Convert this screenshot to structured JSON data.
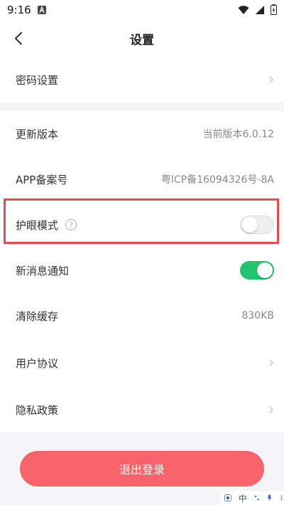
{
  "status_bar": {
    "time": "9:16"
  },
  "header": {
    "title": "设置"
  },
  "rows": {
    "password": {
      "label": "密码设置"
    },
    "update": {
      "label": "更新版本",
      "value": "当前版本6.0.12"
    },
    "app_record": {
      "label": "APP备案号",
      "value": "粤ICP备16094326号-8A"
    },
    "eye_mode": {
      "label": "护眼模式",
      "help": "?",
      "enabled": false
    },
    "notifications": {
      "label": "新消息通知",
      "enabled": true
    },
    "clear_cache": {
      "label": "清除缓存",
      "value": "830KB"
    },
    "user_agreement": {
      "label": "用户协议"
    },
    "privacy": {
      "label": "隐私政策"
    }
  },
  "logout": {
    "label": "退出登录"
  },
  "ime": {
    "lang": "中"
  },
  "colors": {
    "accent": "#f7636a",
    "toggle_on": "#1fc46d",
    "highlight": "#e34b55"
  }
}
